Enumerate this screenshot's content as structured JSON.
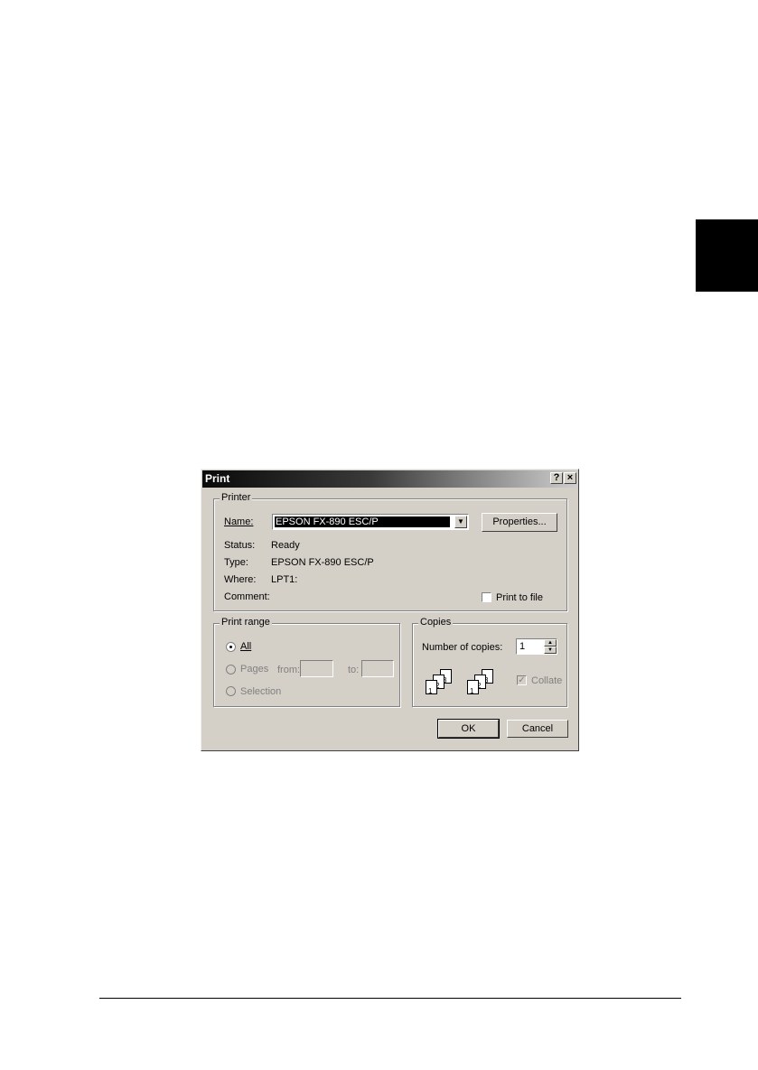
{
  "dialog": {
    "title": "Print",
    "help_glyph": "?",
    "close_glyph": "×"
  },
  "printer": {
    "group_label": "Printer",
    "name_label": "Name:",
    "name_value": "EPSON FX-890 ESC/P",
    "properties_label": "Properties...",
    "status_label": "Status:",
    "status_value": "Ready",
    "type_label": "Type:",
    "type_value": "EPSON FX-890 ESC/P",
    "where_label": "Where:",
    "where_value": "LPT1:",
    "comment_label": "Comment:",
    "print_to_file_label": "Print to file"
  },
  "print_range": {
    "group_label": "Print range",
    "all_label": "All",
    "pages_label": "Pages",
    "from_label": "from:",
    "to_label": "to:",
    "selection_label": "Selection",
    "selected": "All"
  },
  "copies": {
    "group_label": "Copies",
    "number_label": "Number of copies:",
    "number_value": "1",
    "collate_label": "Collate",
    "collate_checked": true,
    "stack1_pages": [
      "1",
      "2",
      "3"
    ],
    "stack2_pages": [
      "1",
      "2",
      "3"
    ]
  },
  "buttons": {
    "ok_label": "OK",
    "cancel_label": "Cancel"
  },
  "icons": {
    "dropdown": "chevron-down-icon",
    "spin_up": "arrow-up-icon",
    "spin_down": "arrow-down-icon"
  }
}
